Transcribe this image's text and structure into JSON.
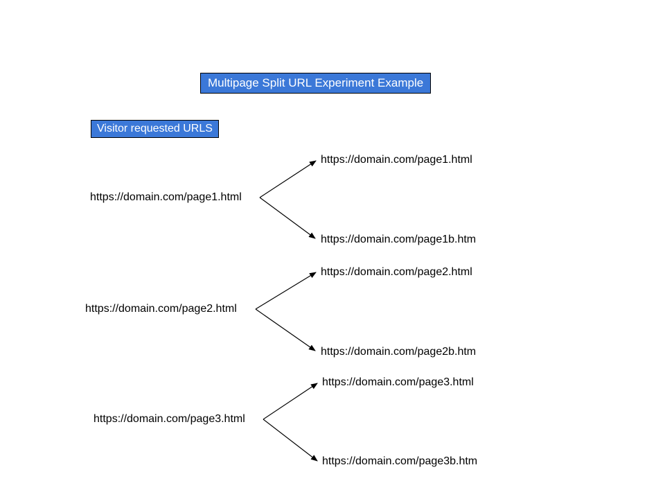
{
  "title": "Multipage Split URL Experiment Example",
  "subtitle": "Visitor requested URLS",
  "rows": [
    {
      "source": "https://domain.com/page1.html",
      "targetA": "https://domain.com/page1.html",
      "targetB": "https://domain.com/page1b.htm"
    },
    {
      "source": "https://domain.com/page2.html",
      "targetA": "https://domain.com/page2.html",
      "targetB": "https://domain.com/page2b.htm"
    },
    {
      "source": "https://domain.com/page3.html",
      "targetA": "https://domain.com/page3.html",
      "targetB": "https://domain.com/page3b.htm"
    }
  ]
}
